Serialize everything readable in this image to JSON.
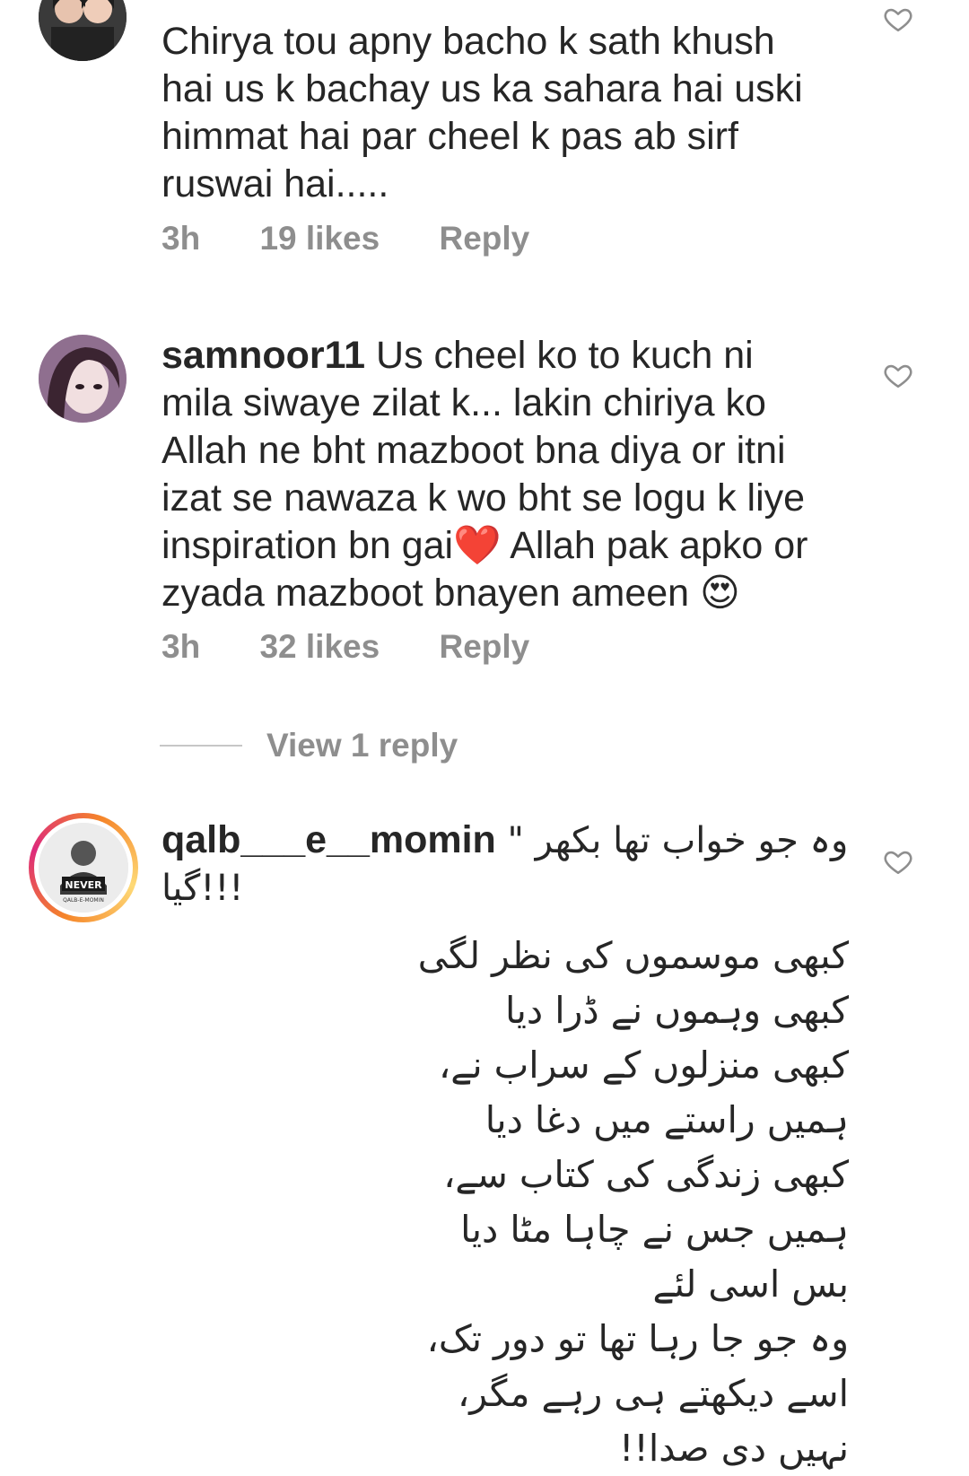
{
  "comments": [
    {
      "username": "",
      "text_lines": [
        "Chirya tou apny bacho k sath khush",
        "hai us k bachay us ka sahara hai uski",
        "himmat hai par cheel k pas ab sirf",
        "ruswai hai....."
      ],
      "time": "3h",
      "likes": "19 likes",
      "reply": "Reply"
    },
    {
      "username": "samnoor11",
      "text_lines": [
        " Us cheel ko to kuch ni",
        "mila siwaye zilat k... lakin chiriya ko",
        "Allah ne bht mazboot bna diya or itni",
        "izat se nawaza k wo bht se logu k liye",
        "inspiration bn gai❤️ Allah pak apko or",
        "zyada mazboot bnayen ameen 😍"
      ],
      "time": "3h",
      "likes": "32 likes",
      "reply": "Reply",
      "view_replies": "View 1 reply"
    },
    {
      "username": "qalb___e__momin",
      "text_lines": [
        " \" وہ جو خواب تھا بکھر",
        "گیا!!!"
      ],
      "poem_lines": [
        "کبھی موسموں کی نظر لگی",
        "کبھی وہموں نے ڈرا دیا",
        "کبھی منزلوں کے سراب نے،",
        "ہمیں راستے میں دغا دیا",
        "کبھی زندگی کی کتاب سے،",
        "ہمیں جس نے چاہا مٹا دیا",
        "بس اسی لئے",
        "وہ جو جا رہا تھا تو دور تک،",
        "اسے دیکھتے ہی رہے مگر،",
        "نہیں دی صدا!!"
      ],
      "avatar_caption": "QALB-E-MOMIN",
      "avatar_text": "NEVER"
    }
  ],
  "icons": {
    "like": "heart-outline-icon"
  },
  "colors": {
    "text": "#262626",
    "meta": "#8e8e8e",
    "heart_stroke": "#8e8e8e",
    "story_ring": [
      "#f58529",
      "#dd2a7b",
      "#feda77"
    ]
  }
}
